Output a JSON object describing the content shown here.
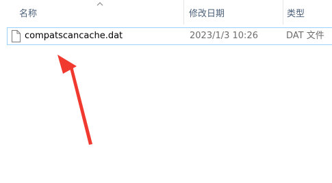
{
  "columns": {
    "name": "名称",
    "date_modified": "修改日期",
    "type": "类型"
  },
  "sort": {
    "column": "name",
    "direction": "ascending",
    "icon": "chevron-up-icon"
  },
  "files": [
    {
      "name": "compatscancache.dat",
      "date_modified": "2023/1/3 10:26",
      "type": "DAT 文件",
      "icon": "file-icon",
      "state": "focused"
    }
  ],
  "annotation": {
    "icon": "red-arrow",
    "color": "#f03a30",
    "points_to": "compatscancache.dat"
  },
  "colors": {
    "header_text": "#4c607a",
    "secondary_text": "#6d6d6d",
    "focus_border": "#99d1ff",
    "separator": "#e5e5e5"
  }
}
